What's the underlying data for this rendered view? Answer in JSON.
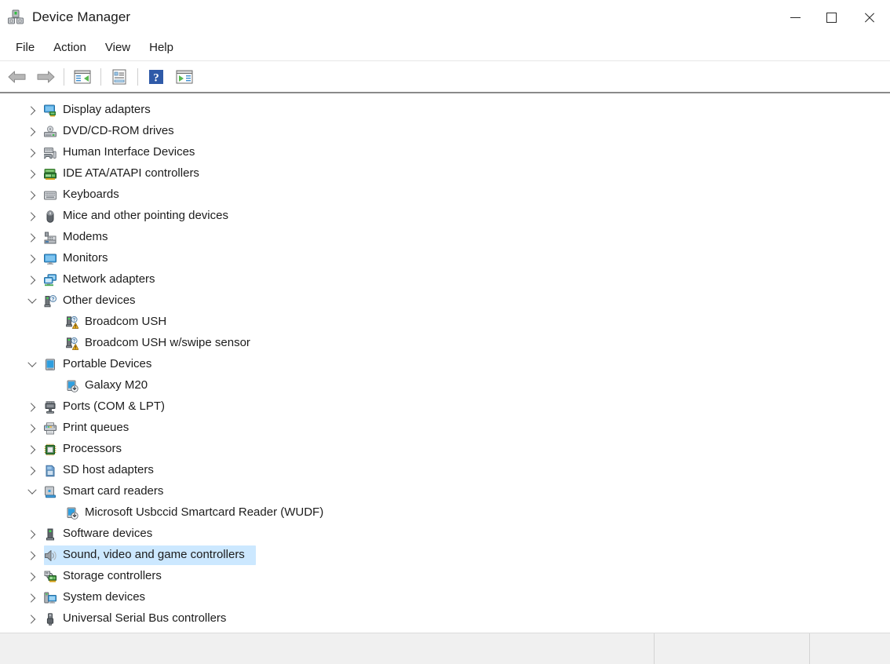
{
  "window": {
    "title": "Device Manager",
    "icon": "device-manager-icon",
    "caption_buttons": [
      {
        "name": "minimize",
        "label": "Minimize"
      },
      {
        "name": "maximize",
        "label": "Maximize"
      },
      {
        "name": "close",
        "label": "Close"
      }
    ]
  },
  "menubar": {
    "items": [
      {
        "label": "File"
      },
      {
        "label": "Action"
      },
      {
        "label": "View"
      },
      {
        "label": "Help"
      }
    ]
  },
  "toolbar": {
    "buttons": [
      {
        "name": "back-button",
        "icon": "back-arrow-icon",
        "label": "Back"
      },
      {
        "name": "forward-button",
        "icon": "forward-arrow-icon",
        "label": "Forward"
      },
      {
        "name": "show-hide-console-tree-button",
        "icon": "console-tree-icon",
        "label": "Show/Hide Console Tree"
      },
      {
        "name": "properties-button",
        "icon": "properties-icon",
        "label": "Properties"
      },
      {
        "name": "help-button",
        "icon": "help-question-icon",
        "label": "Help"
      },
      {
        "name": "scan-hardware-changes-button",
        "icon": "scan-play-icon",
        "label": "Scan for hardware changes"
      }
    ]
  },
  "tree": {
    "selected_label": "Sound, video and game controllers",
    "rows": [
      {
        "label": "Display adapters",
        "level": 0,
        "state": "collapsed",
        "icon": "display-adapter-icon"
      },
      {
        "label": "DVD/CD-ROM drives",
        "level": 0,
        "state": "collapsed",
        "icon": "dvd-drive-icon"
      },
      {
        "label": "Human Interface Devices",
        "level": 0,
        "state": "collapsed",
        "icon": "hid-icon"
      },
      {
        "label": "IDE ATA/ATAPI controllers",
        "level": 0,
        "state": "collapsed",
        "icon": "ide-controller-icon"
      },
      {
        "label": "Keyboards",
        "level": 0,
        "state": "collapsed",
        "icon": "keyboard-icon"
      },
      {
        "label": "Mice and other pointing devices",
        "level": 0,
        "state": "collapsed",
        "icon": "mouse-icon"
      },
      {
        "label": "Modems",
        "level": 0,
        "state": "collapsed",
        "icon": "modem-icon"
      },
      {
        "label": "Monitors",
        "level": 0,
        "state": "collapsed",
        "icon": "monitor-icon"
      },
      {
        "label": "Network adapters",
        "level": 0,
        "state": "collapsed",
        "icon": "network-adapter-icon"
      },
      {
        "label": "Other devices",
        "level": 0,
        "state": "expanded",
        "icon": "unknown-device-icon"
      },
      {
        "label": "Broadcom USH",
        "level": 1,
        "state": "leaf",
        "icon": "warning-device-icon"
      },
      {
        "label": "Broadcom USH w/swipe sensor",
        "level": 1,
        "state": "leaf",
        "icon": "warning-device-icon"
      },
      {
        "label": "Portable Devices",
        "level": 0,
        "state": "expanded",
        "icon": "portable-device-icon"
      },
      {
        "label": "Galaxy M20",
        "level": 1,
        "state": "leaf",
        "icon": "portable-child-icon"
      },
      {
        "label": "Ports (COM & LPT)",
        "level": 0,
        "state": "collapsed",
        "icon": "port-icon"
      },
      {
        "label": "Print queues",
        "level": 0,
        "state": "collapsed",
        "icon": "printer-icon"
      },
      {
        "label": "Processors",
        "level": 0,
        "state": "collapsed",
        "icon": "processor-icon"
      },
      {
        "label": "SD host adapters",
        "level": 0,
        "state": "collapsed",
        "icon": "sd-card-icon"
      },
      {
        "label": "Smart card readers",
        "level": 0,
        "state": "expanded",
        "icon": "smartcard-reader-icon"
      },
      {
        "label": "Microsoft Usbccid Smartcard Reader (WUDF)",
        "level": 1,
        "state": "leaf",
        "icon": "portable-child-icon"
      },
      {
        "label": "Software devices",
        "level": 0,
        "state": "collapsed",
        "icon": "software-device-icon"
      },
      {
        "label": "Sound, video and game controllers",
        "level": 0,
        "state": "collapsed",
        "icon": "speaker-icon",
        "selected": true
      },
      {
        "label": "Storage controllers",
        "level": 0,
        "state": "collapsed",
        "icon": "storage-controller-icon"
      },
      {
        "label": "System devices",
        "level": 0,
        "state": "collapsed",
        "icon": "system-device-icon"
      },
      {
        "label": "Universal Serial Bus controllers",
        "level": 0,
        "state": "collapsed",
        "icon": "usb-icon"
      }
    ]
  },
  "statusbar": {
    "segments": [
      {
        "text": ""
      },
      {
        "text": ""
      },
      {
        "text": ""
      }
    ]
  },
  "colors": {
    "selection": "#cce8ff",
    "text": "#1c1c1c",
    "chrome": "#ffffff",
    "statusbar": "#f0f0f0"
  }
}
